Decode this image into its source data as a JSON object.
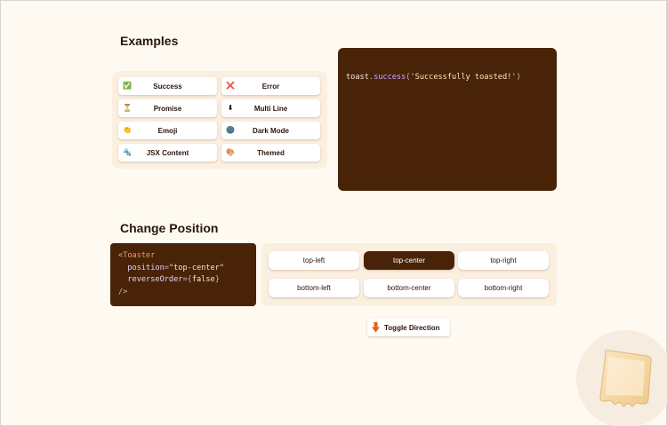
{
  "examples": {
    "heading": "Examples",
    "buttons": [
      {
        "label": "Success",
        "icon": "check-box-icon",
        "glyph": "✅"
      },
      {
        "label": "Error",
        "icon": "cross-icon",
        "glyph": "❌"
      },
      {
        "label": "Promise",
        "icon": "hourglass-icon",
        "glyph": "⏳"
      },
      {
        "label": "Multi Line",
        "icon": "down-arrow-box-icon",
        "glyph": "⬇"
      },
      {
        "label": "Emoji",
        "icon": "clapping-hands-icon",
        "glyph": "👏"
      },
      {
        "label": "Dark Mode",
        "icon": "dark-moon-icon",
        "glyph": "🌚"
      },
      {
        "label": "JSX Content",
        "icon": "wrench-icon",
        "glyph": "🔩"
      },
      {
        "label": "Themed",
        "icon": "paint-palette-icon",
        "glyph": "🎨"
      }
    ],
    "code": {
      "object": "toast",
      "dot": ".",
      "method": "success",
      "open": "(",
      "arg": "'Successfully toasted!'",
      "close": ")"
    }
  },
  "position": {
    "heading": "Change Position",
    "code": {
      "open_tag": "<",
      "tag": "Toaster",
      "attr1": "position",
      "eq1": "=",
      "val1": "\"top-center\"",
      "attr2": "reverseOrder",
      "eq2": "=",
      "brace_open": "{",
      "val2": "false",
      "brace_close": "}",
      "close_tag": "/>"
    },
    "options": [
      "top-left",
      "top-center",
      "top-right",
      "bottom-left",
      "bottom-center",
      "bottom-right"
    ],
    "selected": "top-center",
    "toggle_label": "Toggle Direction",
    "toggle_icon": "down-arrow-icon"
  },
  "colors": {
    "background": "#fffaf1",
    "brand_brown": "#482307",
    "panel": "#fbefe0",
    "accent_orange": "#e0631d"
  }
}
